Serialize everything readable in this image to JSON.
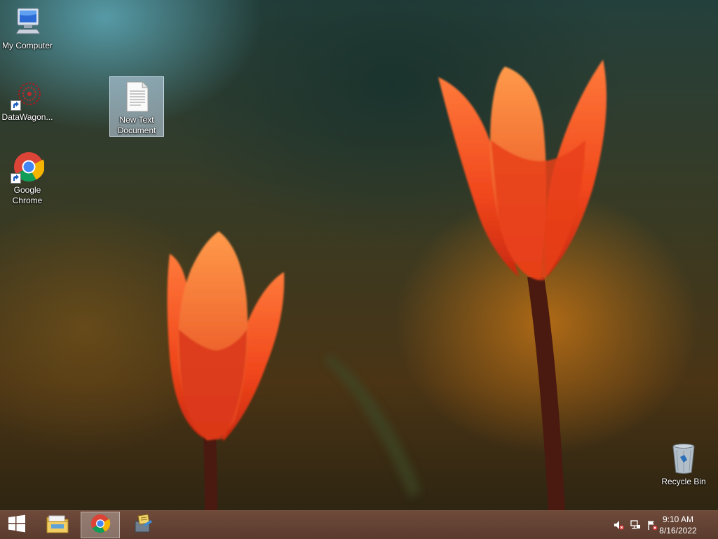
{
  "desktop": {
    "icons": [
      {
        "label": "My Computer"
      },
      {
        "label": "DataWagon..."
      },
      {
        "label": "Google Chrome"
      },
      {
        "label": "New Text Document"
      },
      {
        "label": "Recycle Bin"
      }
    ]
  },
  "taskbar": {
    "buttons": [
      {
        "icon": "windows-logo-icon"
      },
      {
        "icon": "file-explorer-icon"
      },
      {
        "icon": "chrome-icon"
      },
      {
        "icon": "app-icon"
      }
    ],
    "tray": {
      "icons": [
        "speaker-muted-icon",
        "network-icon",
        "action-center-flag-icon"
      ],
      "time": "9:10 AM",
      "date": "8/16/2022"
    }
  },
  "colors": {
    "taskbar": "#5f4032",
    "selection": "#c8dcf0",
    "tulip": "#f0461c"
  }
}
